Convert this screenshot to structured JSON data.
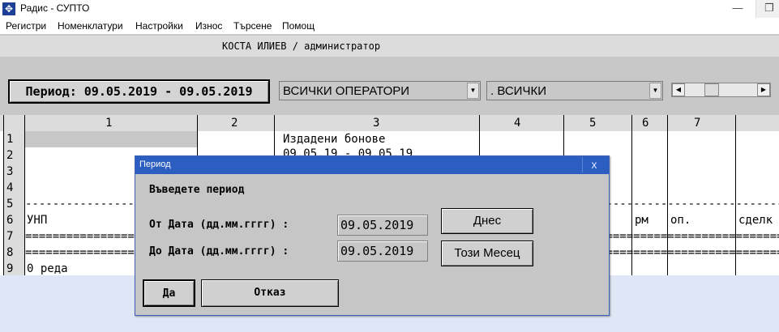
{
  "window": {
    "title": "Радис - СУПТО",
    "app_icon": "✥",
    "minimize": "—",
    "maximize": "❐"
  },
  "menu": [
    "Регистри",
    "Номенклатури",
    "Настройки",
    "Износ",
    "Търсене",
    "Помощ"
  ],
  "user_line": "КОСТА ИЛИЕВ / администратор",
  "toolbar": {
    "period_label": "Период: 09.05.2019 - 09.05.2019",
    "operators_value": "ВСИЧКИ ОПЕРАТОРИ",
    "all_value": ".  ВСИЧКИ",
    "arrow": "▼",
    "sb_left": "◀",
    "sb_right": "▶"
  },
  "grid": {
    "columns": [
      "1",
      "2",
      "3",
      "4",
      "5",
      "6",
      "7"
    ],
    "rows": [
      "1",
      "2",
      "3",
      "4",
      "5",
      "6",
      "7",
      "8",
      "9"
    ],
    "issued_title": "Издадени бонове",
    "issued_dates": "09.05.19 - 09.05.19",
    "dashes": "---------------------------------------------------------------------------------------------------------------------------------------------------------------",
    "equals": "===============================================================================================================================================================",
    "col_unp": "УНП",
    "col_rm": "рм",
    "col_op": "оп.",
    "col_deal": "сделк",
    "row_count": "0 реда"
  },
  "dialog": {
    "title": "Период",
    "close": "x",
    "prompt": "Въведете период",
    "from_label": "От Дата (дд.мм.гггг) :",
    "from_value": "09.05.2019",
    "to_label": "До Дата (дд.мм.гггг) :",
    "to_value": "09.05.2019",
    "today_btn": "Днес",
    "month_btn": "Този Месец",
    "ok_btn": "Да",
    "cancel_btn": "Отказ"
  }
}
